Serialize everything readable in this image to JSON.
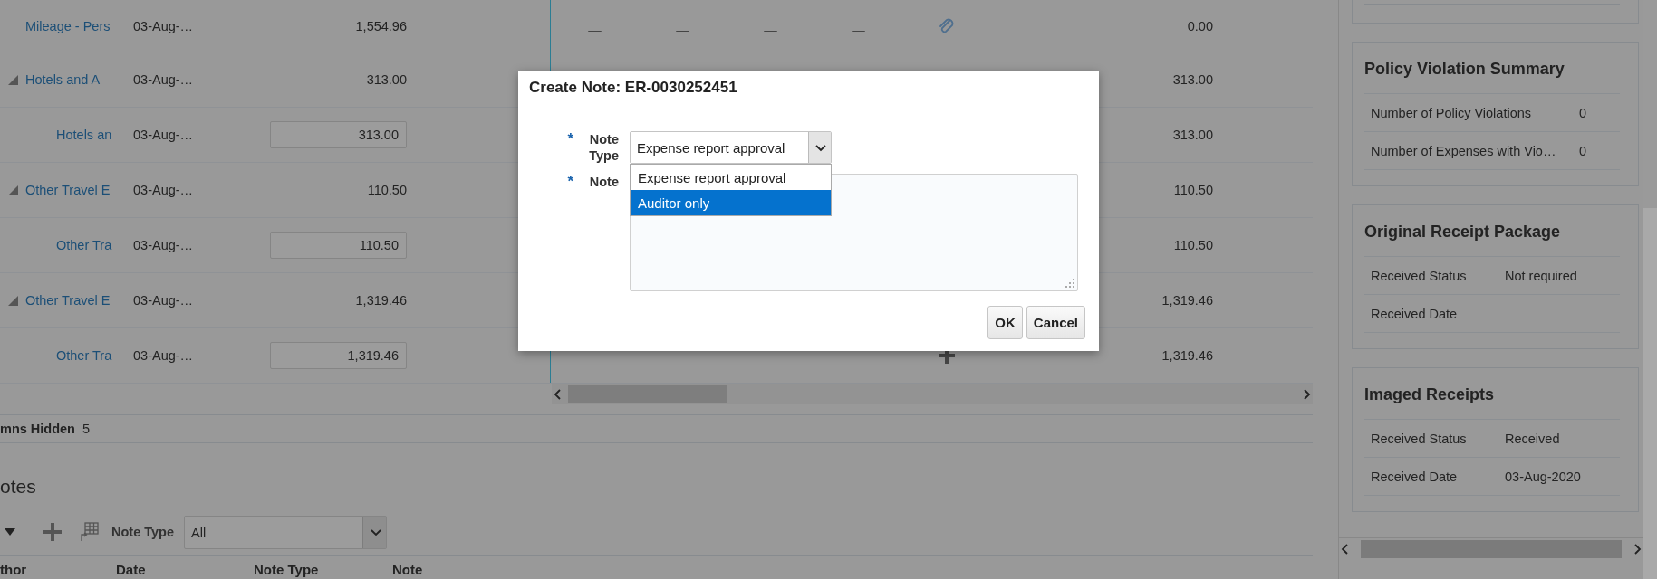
{
  "expense_table": {
    "rows": [
      {
        "name": "Mileage - Pers",
        "date": "03-Aug-…",
        "amount": "1,554.96",
        "dashes": [
          "—",
          "—",
          "—",
          "—"
        ],
        "attachment": true,
        "reimbursable": "0.00"
      },
      {
        "name": "Hotels and A",
        "date": "03-Aug-…",
        "amount": "313.00",
        "reimbursable": "313.00",
        "expanded": true,
        "children": [
          {
            "name": "Hotels an",
            "date": "03-Aug-…",
            "amount": "313.00",
            "reimbursable": "313.00"
          }
        ]
      },
      {
        "name": "Other Travel E",
        "date": "03-Aug-…",
        "amount": "110.50",
        "reimbursable": "110.50",
        "expanded": true,
        "children": [
          {
            "name": "Other Tra",
            "date": "03-Aug-…",
            "amount": "110.50",
            "reimbursable": "110.50"
          }
        ]
      },
      {
        "name": "Other Travel E",
        "date": "03-Aug-…",
        "amount": "1,319.46",
        "reimbursable": "1,319.46",
        "expanded": true,
        "children": [
          {
            "name": "Other Tra",
            "date": "03-Aug-…",
            "amount": "1,319.46",
            "add_action": true,
            "reimbursable": "1,319.46"
          }
        ]
      }
    ]
  },
  "hidden_columns": {
    "label": "mns Hidden",
    "count": "5"
  },
  "notes": {
    "title": "otes",
    "filter_label": "Note Type",
    "filter_value": "All",
    "columns": [
      "thor",
      "Date",
      "Note Type",
      "Note"
    ]
  },
  "side_panels": [
    {
      "title": "Policy Violation Summary",
      "rows": [
        {
          "label": "Number of Policy Violations",
          "value": "0"
        },
        {
          "label": "Number of Expenses with Vio…",
          "value": "0"
        }
      ]
    },
    {
      "title": "Original Receipt Package",
      "rows": [
        {
          "label": "Received Status",
          "value": "Not required"
        },
        {
          "label": "Received Date"
        }
      ]
    },
    {
      "title": "Imaged Receipts",
      "rows": [
        {
          "label": "Received Status",
          "value": "Received"
        },
        {
          "label": "Received Date",
          "value": "03-Aug-2020"
        }
      ]
    }
  ],
  "dialog": {
    "title": "Create Note: ER-0030252451",
    "fields": [
      {
        "kind": "select",
        "label": "Note Type",
        "required_mark": "*",
        "value": "Expense report approval",
        "options": [
          {
            "label": "Expense report approval",
            "highlighted": false
          },
          {
            "label": "Auditor only",
            "highlighted": true
          }
        ]
      },
      {
        "kind": "textarea",
        "label": "Note",
        "required_mark": "*"
      }
    ],
    "buttons": [
      "OK",
      "Cancel"
    ]
  }
}
